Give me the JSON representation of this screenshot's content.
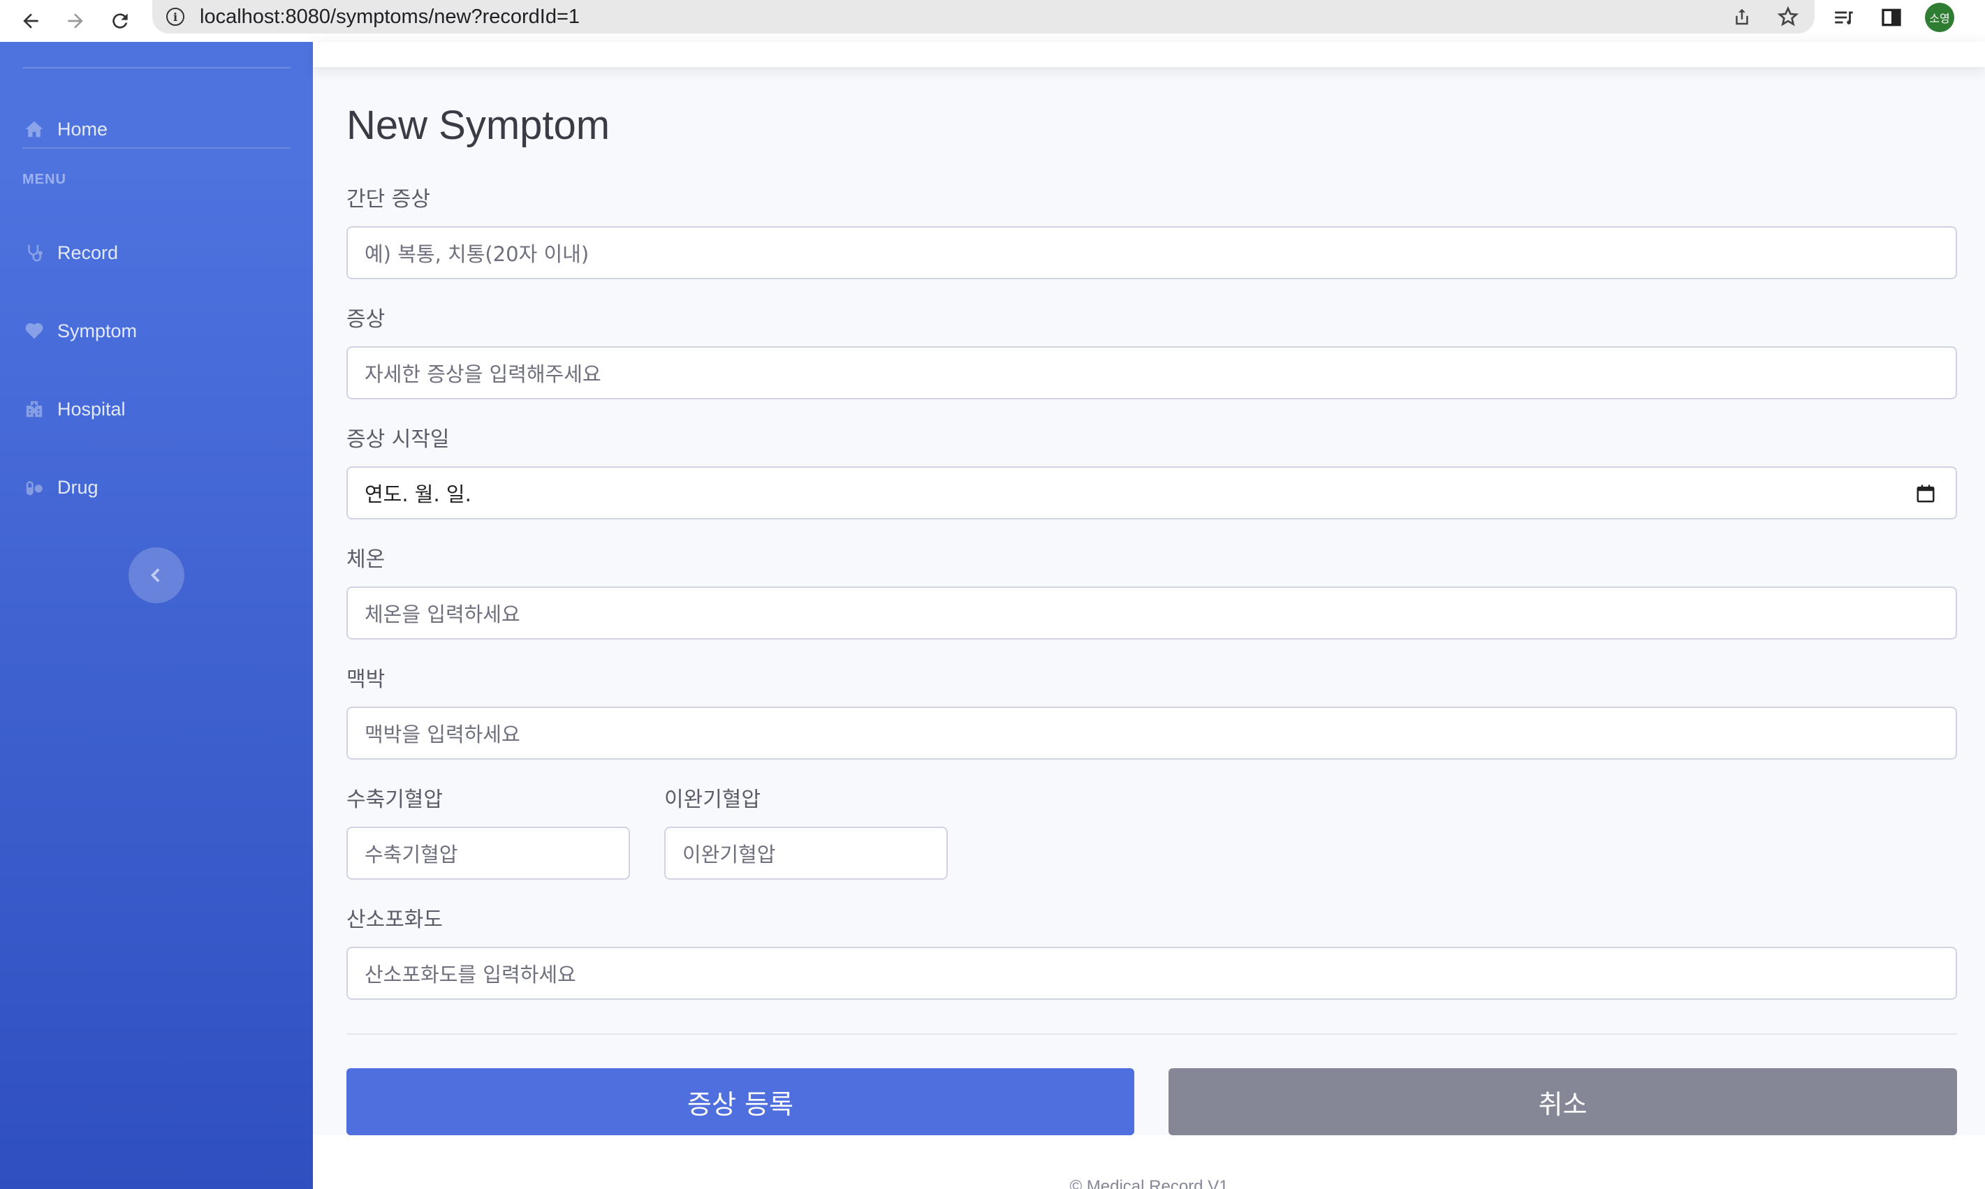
{
  "browser": {
    "url": "localhost:8080/symptoms/new?recordId=1",
    "profile_initials": "소영"
  },
  "sidebar": {
    "items": [
      {
        "label": "Home",
        "icon": "home-icon"
      },
      {
        "label": "Record",
        "icon": "stethoscope-icon"
      },
      {
        "label": "Symptom",
        "icon": "heartbeat-icon"
      },
      {
        "label": "Hospital",
        "icon": "hospital-icon"
      },
      {
        "label": "Drug",
        "icon": "pills-icon"
      }
    ],
    "heading": "MENU"
  },
  "page": {
    "title": "New Symptom"
  },
  "form": {
    "brief_symptom": {
      "label": "간단 증상",
      "placeholder": "예) 복통, 치통(20자 이내)"
    },
    "symptom": {
      "label": "증상",
      "placeholder": "자세한 증상을 입력해주세요"
    },
    "onset_date": {
      "label": "증상 시작일",
      "placeholder": "연도. 월. 일."
    },
    "temperature": {
      "label": "체온",
      "placeholder": "체온을 입력하세요"
    },
    "pulse": {
      "label": "맥박",
      "placeholder": "맥박을 입력하세요"
    },
    "systolic": {
      "label": "수축기혈압",
      "placeholder": "수축기혈압"
    },
    "diastolic": {
      "label": "이완기혈압",
      "placeholder": "이완기혈압"
    },
    "oxygen": {
      "label": "산소포화도",
      "placeholder": "산소포화도를 입력하세요"
    }
  },
  "actions": {
    "submit_label": "증상 등록",
    "cancel_label": "취소"
  },
  "footer": {
    "text": "© Medical Record V1"
  },
  "colors": {
    "sidebar_top": "#4e73df",
    "sidebar_bottom": "#2f4fc0",
    "primary": "#4e6fdd",
    "secondary": "#858796"
  }
}
